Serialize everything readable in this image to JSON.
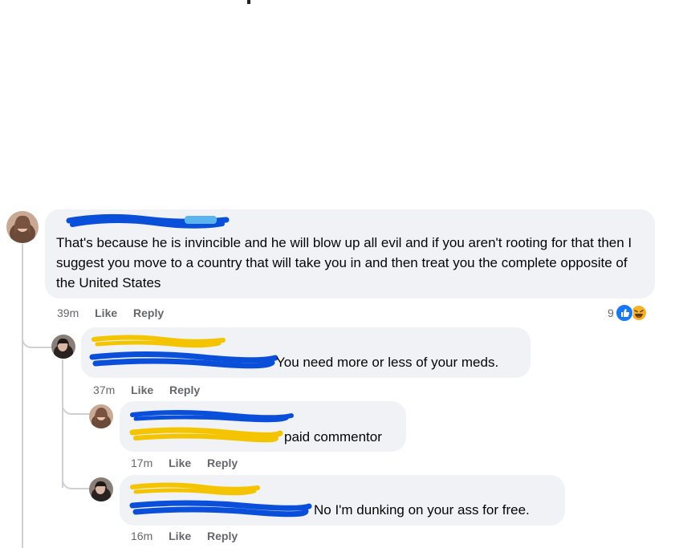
{
  "comments": [
    {
      "text": "That's because he is invincible and he will blow up all evil and if you aren't rooting for that then I suggest you move to a country that will take you in and then treat you the complete opposite of the United States",
      "time": "39m",
      "like_label": "Like",
      "reply_label": "Reply",
      "reaction_count": "9",
      "reactions": [
        "like-icon",
        "laughing-emoji-icon"
      ]
    },
    {
      "text": "You need more or less of your meds.",
      "time": "37m",
      "like_label": "Like",
      "reply_label": "Reply"
    },
    {
      "text": "paid commentor",
      "time": "17m",
      "like_label": "Like",
      "reply_label": "Reply"
    },
    {
      "text": "No I'm dunking on your ass for free.",
      "time": "16m",
      "like_label": "Like",
      "reply_label": "Reply"
    }
  ],
  "colors": {
    "bubble": "#f0f2f5",
    "meta_text": "#65676b",
    "redact_blue": "#0a4fd9",
    "redact_yellow": "#f5c400",
    "like_blue": "#1877f2"
  }
}
